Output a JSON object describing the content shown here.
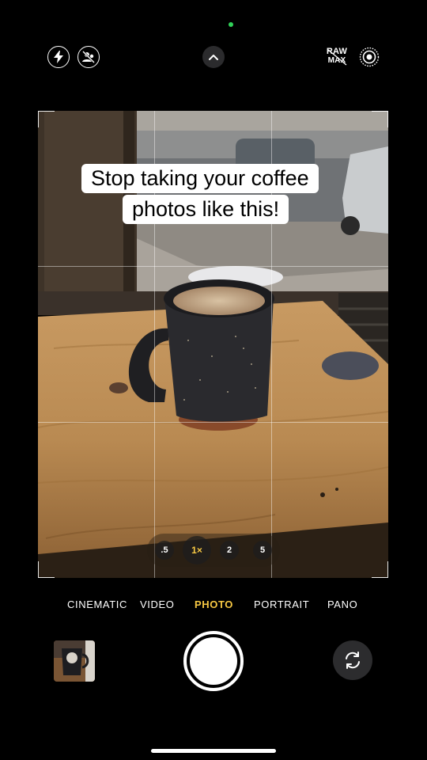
{
  "caption": {
    "line1": "Stop taking your coffee",
    "line2": "photos like this!"
  },
  "top_bar": {
    "icons": [
      "flash-icon",
      "live-photo-off-icon",
      "chevron-up-icon",
      "raw-max-badge",
      "live-photo-icon"
    ],
    "raw_line1": "RAW",
    "raw_line2": "MAX"
  },
  "zoom": {
    "options": [
      ".5",
      "1×",
      "2",
      "5"
    ],
    "selected": "1×"
  },
  "modes": {
    "items": [
      "CINEMATIC",
      "VIDEO",
      "PHOTO",
      "PORTRAIT",
      "PANO"
    ],
    "selected": "PHOTO"
  },
  "colors": {
    "accent": "#f7c843",
    "background": "#000000",
    "status_dot": "#30d158"
  }
}
